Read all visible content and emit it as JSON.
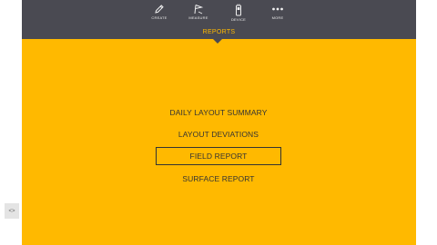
{
  "nav": {
    "items": [
      {
        "label": "CREATE",
        "icon": "pencil-icon"
      },
      {
        "label": "MEASURE",
        "icon": "flag-icon"
      },
      {
        "label": "DEVICE",
        "icon": "device-icon"
      },
      {
        "label": "MORE",
        "icon": "more-icon"
      }
    ]
  },
  "section": {
    "title": "REPORTS"
  },
  "reports": {
    "items": [
      {
        "label": "DAILY LAYOUT SUMMARY",
        "selected": false
      },
      {
        "label": "LAYOUT DEVIATIONS",
        "selected": false
      },
      {
        "label": "FIELD REPORT",
        "selected": true
      },
      {
        "label": "SURFACE REPORT",
        "selected": false
      }
    ]
  },
  "side_control": {
    "label": "<>",
    "icon": "collapse-arrows-icon"
  },
  "colors": {
    "topbar": "#4a4a52",
    "accent": "#ffb900",
    "text": "#333333"
  }
}
